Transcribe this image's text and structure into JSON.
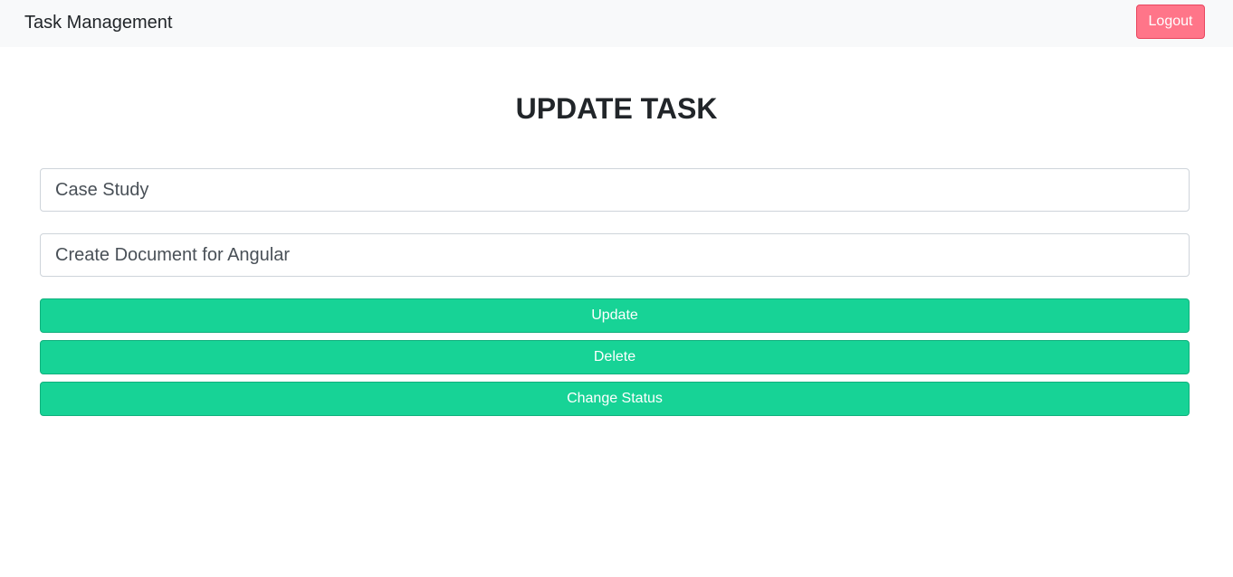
{
  "navbar": {
    "brand": "Task Management",
    "logout_label": "Logout"
  },
  "page": {
    "title": "UPDATE TASK"
  },
  "form": {
    "task_title_value": "Case Study",
    "task_description_value": "Create Document for Angular"
  },
  "actions": {
    "update_label": "Update",
    "delete_label": "Delete",
    "change_status_label": "Change Status"
  },
  "colors": {
    "navbar_bg": "#f8f9fa",
    "logout_bg": "#ff7589",
    "action_bg": "#17d396"
  }
}
